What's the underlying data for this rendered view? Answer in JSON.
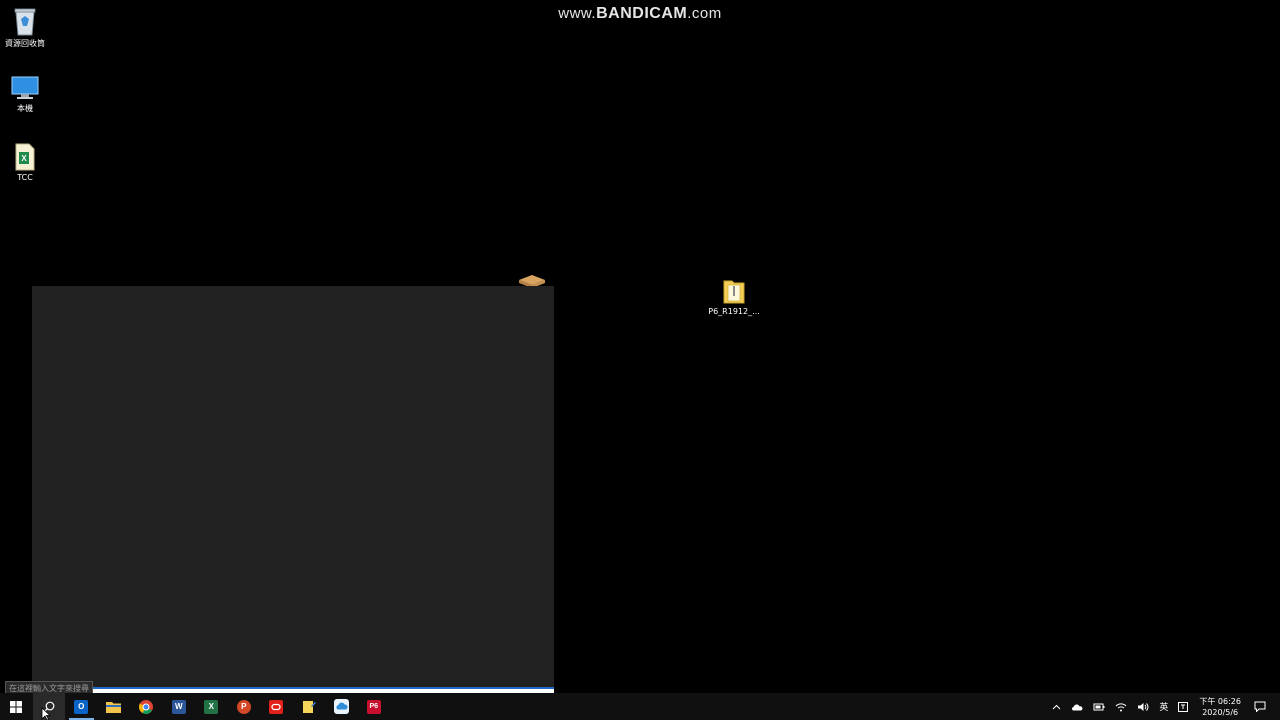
{
  "watermark": {
    "prefix": "www.",
    "brand": "BANDICAM",
    "suffix": ".com"
  },
  "desktop": {
    "icons": [
      {
        "label": "資源回收筒",
        "icon": "recycle-bin-icon"
      },
      {
        "label": "本機",
        "icon": "this-pc-icon"
      },
      {
        "label": "TCC",
        "icon": "excel-file-icon"
      },
      {
        "label": "P6_R1912_...",
        "icon": "zip-folder-icon"
      }
    ]
  },
  "start_menu": {
    "search_tooltip": "在這裡輸入文字來搜尋"
  },
  "taskbar": {
    "apps": [
      {
        "name": "start",
        "icon": "windows-start-icon"
      },
      {
        "name": "search",
        "icon": "search-icon"
      },
      {
        "name": "outlook",
        "icon": "outlook-icon",
        "letter": "O",
        "color": "#0a64c8"
      },
      {
        "name": "file-explorer",
        "icon": "folder-icon"
      },
      {
        "name": "chrome",
        "icon": "chrome-icon"
      },
      {
        "name": "word",
        "icon": "word-icon",
        "letter": "W",
        "color": "#2b579a"
      },
      {
        "name": "excel",
        "icon": "excel-icon",
        "letter": "X",
        "color": "#217346"
      },
      {
        "name": "powerpoint",
        "icon": "powerpoint-icon",
        "letter": "P",
        "color": "#d24726"
      },
      {
        "name": "oracle",
        "icon": "oracle-icon",
        "color": "#e0201b"
      },
      {
        "name": "sticky-notes",
        "icon": "note-pen-icon"
      },
      {
        "name": "onedrive-app",
        "icon": "cloud-app-icon"
      },
      {
        "name": "primavera-p6",
        "icon": "p6-icon",
        "letter": "P6",
        "color": "#c8102e"
      }
    ],
    "tray": {
      "language": "英",
      "time": "下午 06:26",
      "date": "2020/5/6"
    }
  }
}
